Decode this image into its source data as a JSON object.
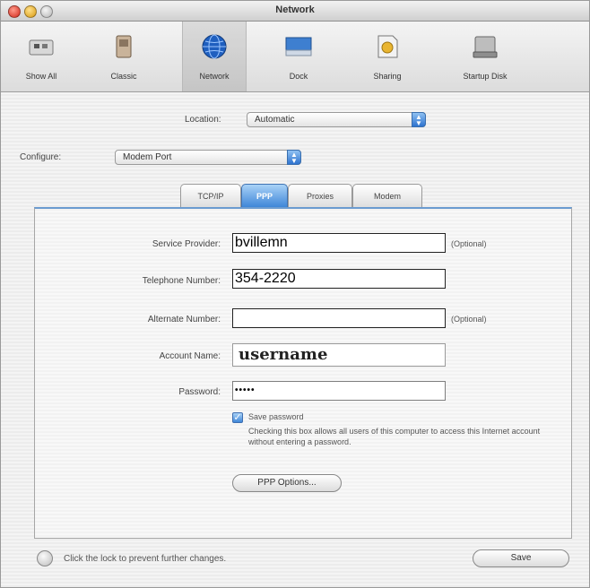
{
  "window": {
    "title": "Network"
  },
  "toolbar": {
    "items": [
      {
        "label": "Show All",
        "icon": "show-all-icon"
      },
      {
        "label": "Classic",
        "icon": "classic-icon"
      },
      {
        "label": "Network",
        "icon": "network-globe-icon"
      },
      {
        "label": "Dock",
        "icon": "dock-icon"
      },
      {
        "label": "Sharing",
        "icon": "sharing-icon"
      },
      {
        "label": "Startup Disk",
        "icon": "startup-disk-icon"
      }
    ],
    "selected_index": 2
  },
  "location": {
    "label": "Location:",
    "value": "Automatic"
  },
  "configure": {
    "label": "Configure:",
    "value": "Modem Port"
  },
  "tabs": [
    {
      "label": "TCP/IP"
    },
    {
      "label": "PPP"
    },
    {
      "label": "Proxies"
    },
    {
      "label": "Modem"
    }
  ],
  "active_tab": "PPP",
  "form": {
    "service_provider": {
      "label": "Service Provider:",
      "value": "bvillemn",
      "note": "(Optional)"
    },
    "telephone_number": {
      "label": "Telephone Number:",
      "value": "354-2220"
    },
    "alternate_number": {
      "label": "Alternate Number:",
      "value": "",
      "note": "(Optional)"
    },
    "account_name": {
      "label": "Account Name:",
      "value": "username"
    },
    "password": {
      "label": "Password:",
      "value": "•••••"
    },
    "save_password": {
      "label": "Save password",
      "checked": true,
      "help": "Checking this box allows all users of this computer to access this Internet account without entering a password."
    },
    "ppp_options_button": "PPP Options..."
  },
  "footer": {
    "lock_text": "Click the lock to prevent further changes.",
    "save_button": "Save"
  },
  "colors": {
    "accent": "#3f86d8"
  }
}
